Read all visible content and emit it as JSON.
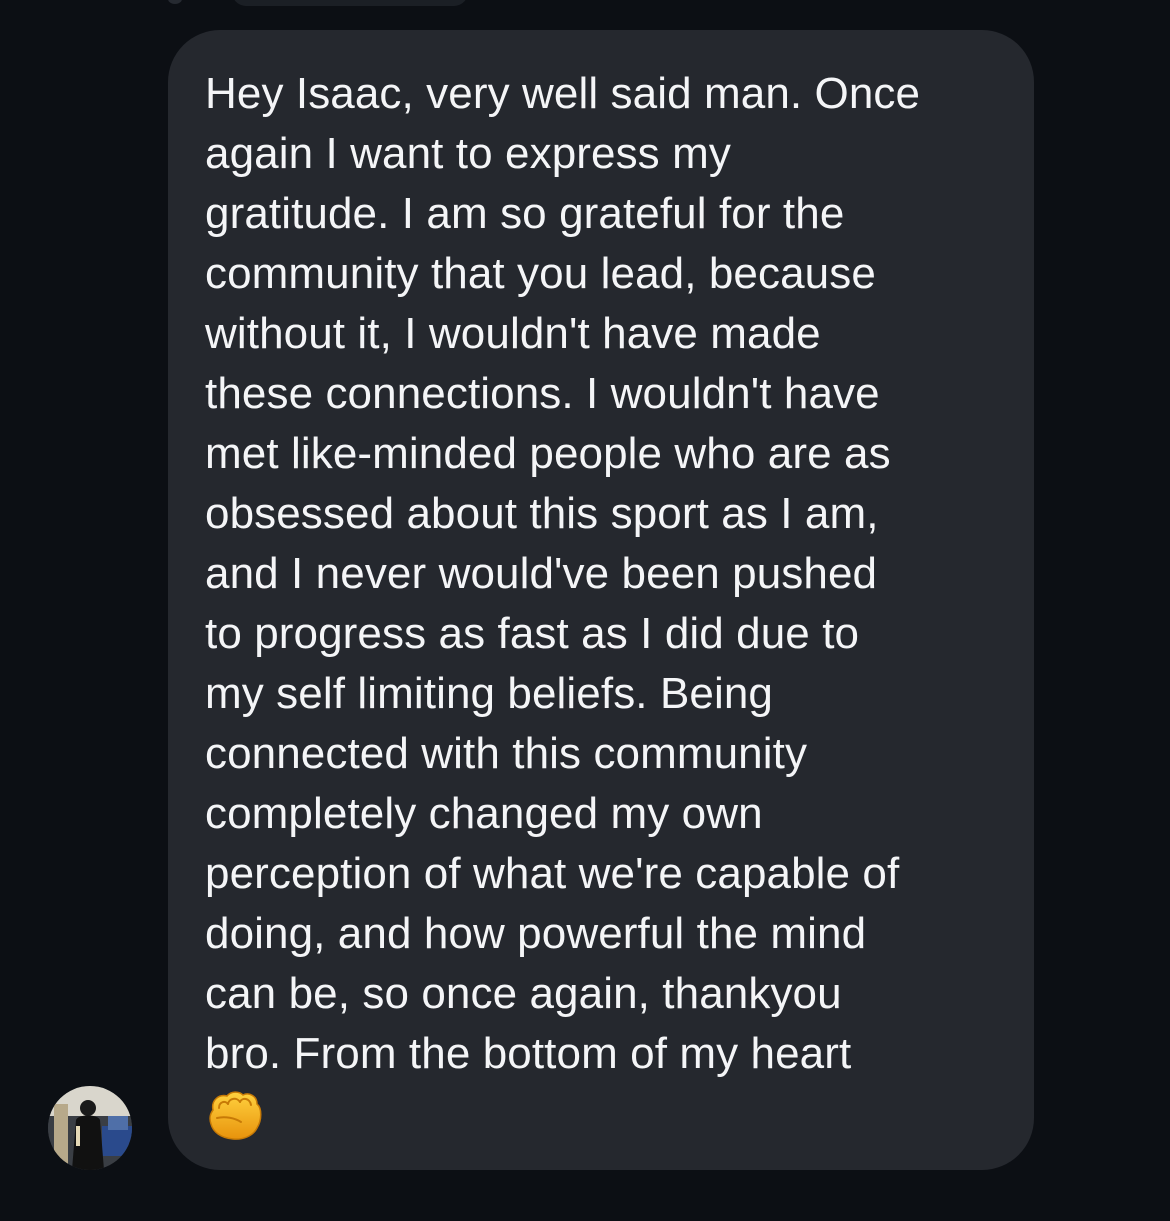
{
  "conversation": {
    "message": {
      "lines": [
        "Hey Isaac, very well said man. Once",
        "again I want to express my",
        "gratitude. I am so grateful for the",
        "community that you lead, because",
        "without it, I wouldn't have made",
        "these connections. I wouldn't have",
        "met like-minded people who are as",
        "obsessed about this sport as I am,",
        "and I never would've been pushed",
        "to progress as fast as I did due to",
        "my self limiting beliefs. Being",
        "connected with this community",
        "completely changed my own",
        "perception of what we're capable of",
        "doing, and how powerful the mind",
        "can be, so once again, thankyou",
        "bro. From the bottom of my heart"
      ],
      "emoji": "oncoming-fist-icon"
    },
    "sender": {
      "avatar": "avatar-photo"
    }
  },
  "colors": {
    "background": "#0c0f14",
    "bubble": "#25282e",
    "text": "#f4f5f7",
    "emoji_fist": "#f5b21a"
  }
}
